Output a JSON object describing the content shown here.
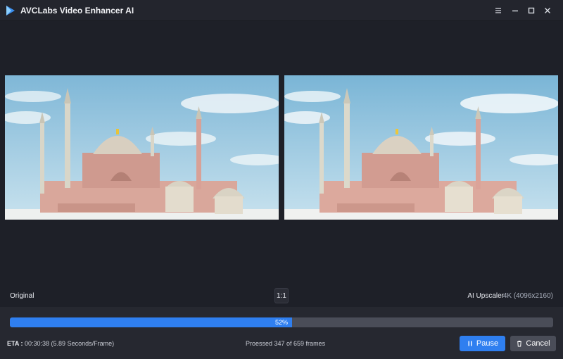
{
  "app": {
    "title": "AVCLabs Video Enhancer AI",
    "accent_color": "#2f7ff0"
  },
  "window_controls": [
    "menu-icon",
    "minimize-icon",
    "maximize-icon",
    "close-icon"
  ],
  "preview": {
    "left_label": "Original",
    "ratio_button": "1:1",
    "model_label": "AI Upscaler",
    "resolution": "4K (4096x2160)"
  },
  "progress": {
    "percent": 52,
    "percent_label": "52%"
  },
  "status": {
    "eta_label": "ETA :",
    "eta_value": "00:30:38 (5.89 Seconds/Frame)",
    "processed": "Proessed 347 of 659 frames"
  },
  "buttons": {
    "pause": "Pause",
    "cancel": "Cancel"
  }
}
